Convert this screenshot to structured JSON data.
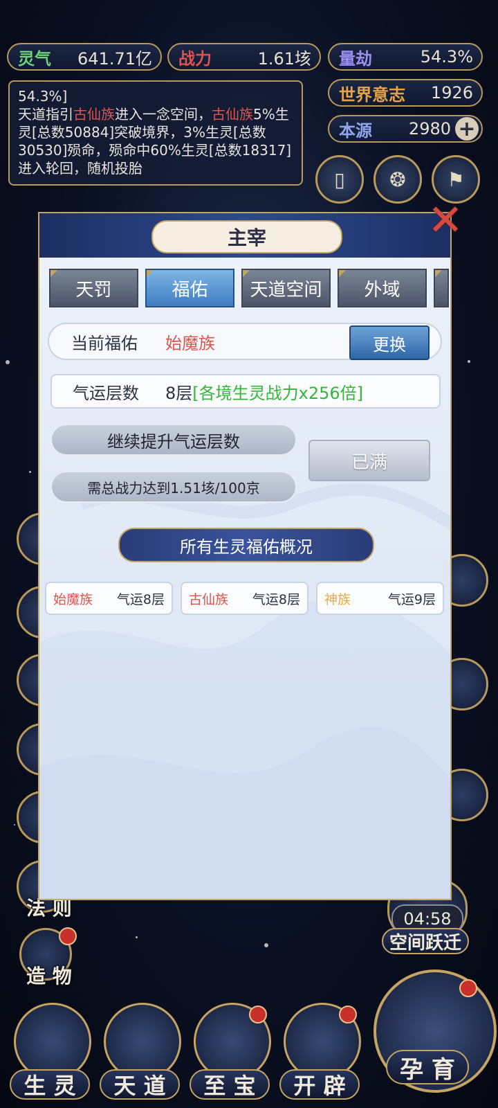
{
  "top_stats": {
    "lingqi": {
      "label": "灵气",
      "value": "641.71亿",
      "color": "#6fd27a"
    },
    "zhanli": {
      "label": "战力",
      "value": "1.61垓",
      "color": "#e0524c"
    },
    "liangjie": {
      "label": "量劫",
      "value": "54.3%",
      "color": "#9a8ff2"
    },
    "world_will": {
      "label": "世界意志",
      "value": "1926",
      "color": "#e7a346"
    },
    "benyuan": {
      "label": "本源",
      "value": "2980",
      "color": "#8ea7f0"
    }
  },
  "log": {
    "line0": "54.3%]",
    "text_a": "天道指引",
    "race_a": "古仙族",
    "text_b": "进入一念空间，",
    "race_b": "古仙族",
    "text_c": "5%生灵[总数50884]突破境界，3%生灵[总数30530]殒命，殒命中60%生灵[总数18317]进入轮回，随机投胎"
  },
  "dialog": {
    "title": "主宰",
    "tabs": [
      "天罚",
      "福佑",
      "天道空间",
      "外域"
    ],
    "active_tab": "福佑",
    "current_blessing_label": "当前福佑",
    "current_blessing_value": "始魔族",
    "swap_button": "更换",
    "luck_label": "气运层数",
    "luck_value": "8层",
    "luck_bonus": "[各境生灵战力x256倍]",
    "upgrade_title": "继续提升气运层数",
    "upgrade_requirement": "需总战力达到1.51垓/100京",
    "full_button": "已满",
    "overview_button": "所有生灵福佑概况",
    "races": [
      {
        "name": "始魔族",
        "luck": "气运8层",
        "color": "#e0524c"
      },
      {
        "name": "古仙族",
        "luck": "气运8层",
        "color": "#e0524c"
      },
      {
        "name": "神族",
        "luck": "气运9层",
        "color": "#e9a93a"
      }
    ]
  },
  "side_labels": {
    "law": "法 则",
    "creation": "造 物"
  },
  "timer": "04:58",
  "space_jump": "空间跃迁",
  "bottom_nav": [
    "生 灵",
    "天 道",
    "至 宝",
    "开 辟"
  ],
  "big_nav": "孕 育"
}
